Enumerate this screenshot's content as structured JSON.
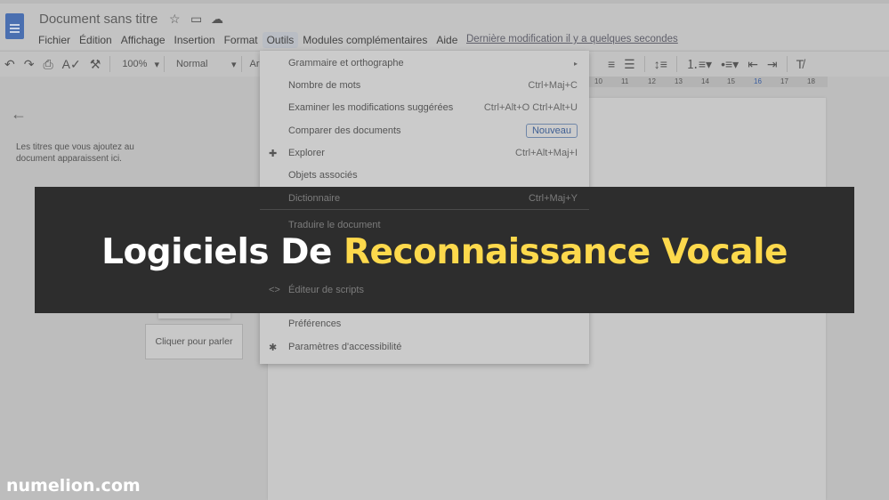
{
  "app": {
    "title": "Document sans titre",
    "icons": [
      "star-icon",
      "folder-icon",
      "cloud-icon"
    ],
    "menu": [
      "Fichier",
      "Édition",
      "Affichage",
      "Insertion",
      "Format",
      "Outils",
      "Modules complémentaires",
      "Aide"
    ],
    "active_menu": "Outils",
    "last_modified": "Dernière modification il y a quelques secondes"
  },
  "toolbar": {
    "zoom": "100%",
    "style": "Normal",
    "font": "Ari"
  },
  "ruler": [
    "10",
    "11",
    "12",
    "13",
    "14",
    "15",
    "16",
    "17",
    "18"
  ],
  "outline": {
    "text": "Les titres que vous ajoutez au document apparaissent ici."
  },
  "voice": {
    "tooltip": "Cliquer pour parler"
  },
  "tools_menu": [
    {
      "label": "Grammaire et orthographe",
      "shortcut": "▸"
    },
    {
      "label": "Nombre de mots",
      "shortcut": "Ctrl+Maj+C"
    },
    {
      "label": "Examiner les modifications suggérées",
      "shortcut": "Ctrl+Alt+O Ctrl+Alt+U"
    },
    {
      "label": "Comparer des documents",
      "badge": "Nouveau"
    },
    {
      "label": "Explorer",
      "shortcut": "Ctrl+Alt+Maj+I"
    },
    {
      "label": "Objets associés",
      "shortcut": ""
    },
    {
      "label": "Dictionnaire",
      "shortcut": "Ctrl+Maj+Y"
    },
    {
      "label": "Traduire le document",
      "shortcut": ""
    },
    {
      "label": "Éditeur de scripts",
      "shortcut": ""
    },
    {
      "label": "Préférences",
      "shortcut": ""
    },
    {
      "label": "Paramètres d'accessibilité",
      "shortcut": ""
    }
  ],
  "banner": {
    "part1": "Logiciels De ",
    "part2": "Reconnaissance Vocale",
    "accent": "#fdd94c",
    "background": "#2d2d2d"
  },
  "brand": "numelion.com"
}
